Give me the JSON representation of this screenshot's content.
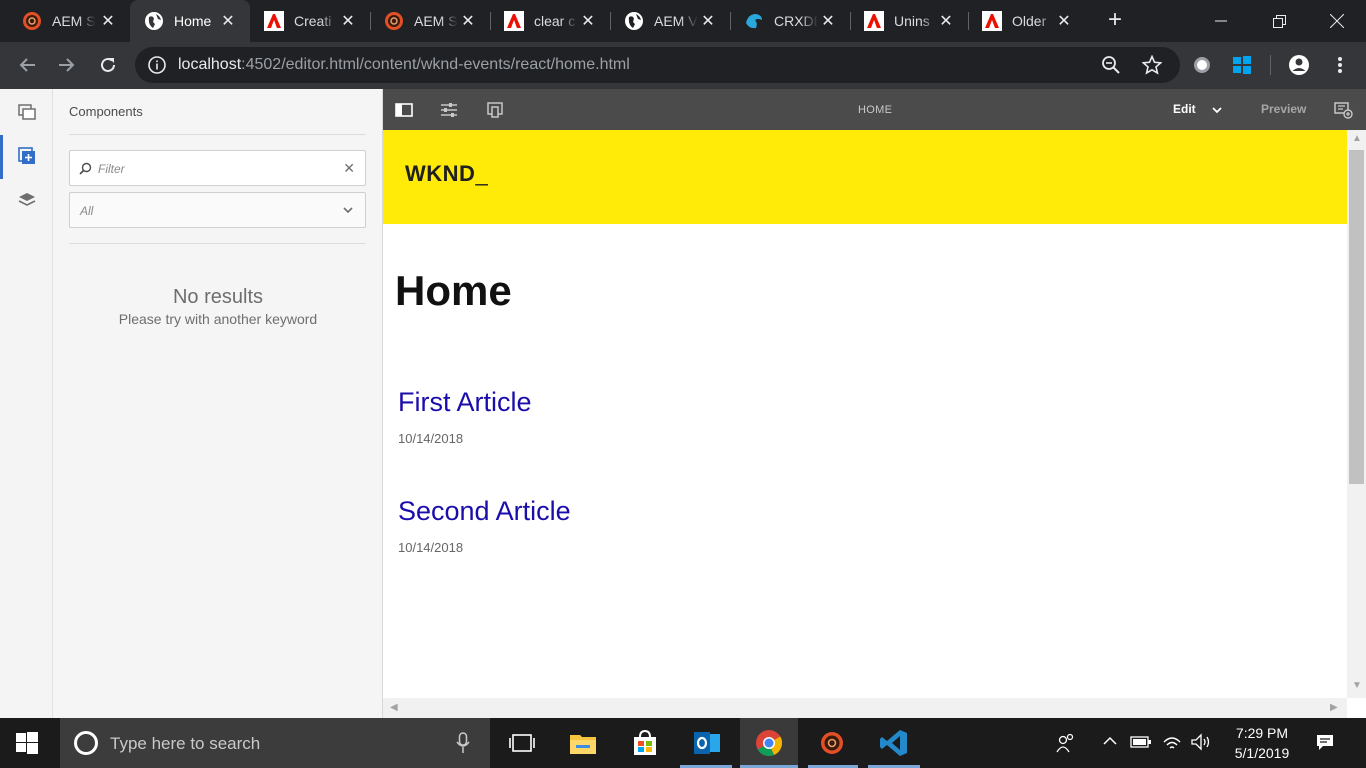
{
  "browser": {
    "tabs": [
      {
        "title": "AEM S",
        "favicon": "aem-icon"
      },
      {
        "title": "Home",
        "favicon": "globe-icon"
      },
      {
        "title": "Creati",
        "favicon": "adobe-icon"
      },
      {
        "title": "AEM S",
        "favicon": "aem-icon"
      },
      {
        "title": "clear c",
        "favicon": "adobe-icon"
      },
      {
        "title": "AEM V",
        "favicon": "globe-icon"
      },
      {
        "title": "CRXDE",
        "favicon": "crxde-icon"
      },
      {
        "title": "Unins",
        "favicon": "adobe-icon"
      },
      {
        "title": "Older",
        "favicon": "adobe-icon"
      }
    ],
    "active_tab_index": 1,
    "url_host": "localhost",
    "url_rest": ":4502/editor.html/content/wknd-events/react/home.html"
  },
  "editor": {
    "panel_title": "Components",
    "filter_placeholder": "Filter",
    "group_select_value": "All",
    "no_results": "No results",
    "no_results_hint": "Please try with another keyword",
    "page_title": "HOME",
    "mode_label": "Edit",
    "preview_label": "Preview"
  },
  "page": {
    "logo": "WKND",
    "logo_suffix": "_",
    "heading": "Home",
    "articles": [
      {
        "title": "First Article",
        "date": "10/14/2018"
      },
      {
        "title": "Second Article",
        "date": "10/14/2018"
      }
    ],
    "header_color": "#ffea08",
    "link_color": "#1a0dab"
  },
  "taskbar": {
    "search_placeholder": "Type here to search",
    "time": "7:29 PM",
    "date": "5/1/2019"
  }
}
